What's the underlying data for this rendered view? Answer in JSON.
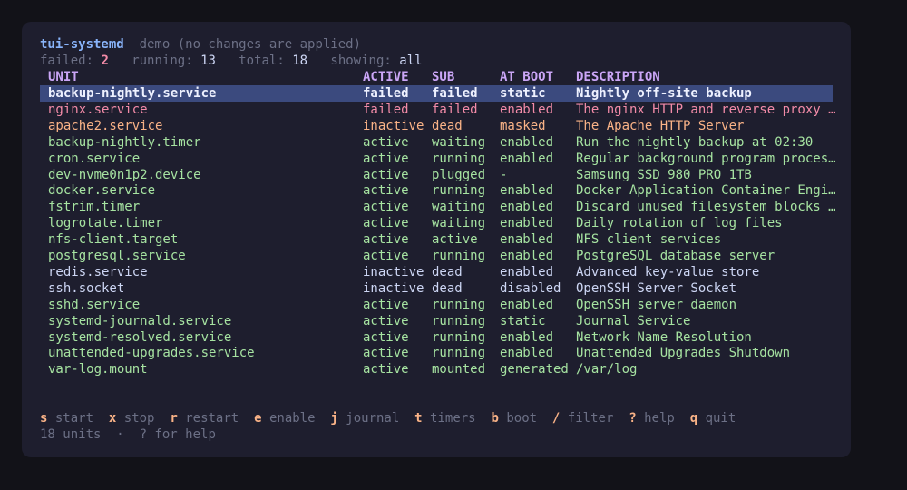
{
  "header": {
    "app_name": "tui-systemd",
    "mode_note": "demo (no changes are applied)",
    "failed_label": "failed:",
    "failed_count": "2",
    "running_label": "running:",
    "running_count": "13",
    "total_label": "total:",
    "total_count": "18",
    "showing_label": "showing:",
    "showing_value": "all"
  },
  "columns": [
    "UNIT",
    "ACTIVE",
    "SUB",
    "AT BOOT",
    "DESCRIPTION"
  ],
  "rows": [
    {
      "unit": "backup-nightly.service",
      "active": "failed",
      "sub": "failed",
      "boot": "static",
      "desc": "Nightly off-site backup",
      "state": "failed",
      "selected": true
    },
    {
      "unit": "nginx.service",
      "active": "failed",
      "sub": "failed",
      "boot": "enabled",
      "desc": "The nginx HTTP and reverse proxy …",
      "state": "failed"
    },
    {
      "unit": "apache2.service",
      "active": "inactive",
      "sub": "dead",
      "boot": "masked",
      "desc": "The Apache HTTP Server",
      "state": "inactive"
    },
    {
      "unit": "backup-nightly.timer",
      "active": "active",
      "sub": "waiting",
      "boot": "enabled",
      "desc": "Run the nightly backup at 02:30",
      "state": "active"
    },
    {
      "unit": "cron.service",
      "active": "active",
      "sub": "running",
      "boot": "enabled",
      "desc": "Regular background program proces…",
      "state": "active"
    },
    {
      "unit": "dev-nvme0n1p2.device",
      "active": "active",
      "sub": "plugged",
      "boot": "-",
      "desc": "Samsung SSD 980 PRO 1TB",
      "state": "active"
    },
    {
      "unit": "docker.service",
      "active": "active",
      "sub": "running",
      "boot": "enabled",
      "desc": "Docker Application Container Engi…",
      "state": "active"
    },
    {
      "unit": "fstrim.timer",
      "active": "active",
      "sub": "waiting",
      "boot": "enabled",
      "desc": "Discard unused filesystem blocks …",
      "state": "active"
    },
    {
      "unit": "logrotate.timer",
      "active": "active",
      "sub": "waiting",
      "boot": "enabled",
      "desc": "Daily rotation of log files",
      "state": "active"
    },
    {
      "unit": "nfs-client.target",
      "active": "active",
      "sub": "active",
      "boot": "enabled",
      "desc": "NFS client services",
      "state": "active"
    },
    {
      "unit": "postgresql.service",
      "active": "active",
      "sub": "running",
      "boot": "enabled",
      "desc": "PostgreSQL database server",
      "state": "active"
    },
    {
      "unit": "redis.service",
      "active": "inactive",
      "sub": "dead",
      "boot": "enabled",
      "desc": "Advanced key-value store",
      "state": "plain"
    },
    {
      "unit": "ssh.socket",
      "active": "inactive",
      "sub": "dead",
      "boot": "disabled",
      "desc": "OpenSSH Server Socket",
      "state": "plain"
    },
    {
      "unit": "sshd.service",
      "active": "active",
      "sub": "running",
      "boot": "enabled",
      "desc": "OpenSSH server daemon",
      "state": "active"
    },
    {
      "unit": "systemd-journald.service",
      "active": "active",
      "sub": "running",
      "boot": "static",
      "desc": "Journal Service",
      "state": "active"
    },
    {
      "unit": "systemd-resolved.service",
      "active": "active",
      "sub": "running",
      "boot": "enabled",
      "desc": "Network Name Resolution",
      "state": "active"
    },
    {
      "unit": "unattended-upgrades.service",
      "active": "active",
      "sub": "running",
      "boot": "enabled",
      "desc": "Unattended Upgrades Shutdown",
      "state": "active"
    },
    {
      "unit": "var-log.mount",
      "active": "active",
      "sub": "mounted",
      "boot": "generated",
      "desc": "/var/log",
      "state": "active"
    }
  ],
  "keybar": [
    {
      "key": "s",
      "label": "start"
    },
    {
      "key": "x",
      "label": "stop"
    },
    {
      "key": "r",
      "label": "restart"
    },
    {
      "key": "e",
      "label": "enable"
    },
    {
      "key": "j",
      "label": "journal"
    },
    {
      "key": "t",
      "label": "timers"
    },
    {
      "key": "b",
      "label": "boot"
    },
    {
      "key": "/",
      "label": "filter"
    },
    {
      "key": "?",
      "label": "help"
    },
    {
      "key": "q",
      "label": "quit"
    }
  ],
  "status": {
    "units_text": "18 units",
    "separator": "·",
    "help_hint": "? for help"
  },
  "colors": {
    "background": "#1e1e2e",
    "failed": "#f38ba8",
    "inactive": "#fab387",
    "active": "#a6e3a1",
    "selected_row": "#3b4a7e",
    "header": "#cba6f7",
    "app_name": "#89b4fa"
  }
}
